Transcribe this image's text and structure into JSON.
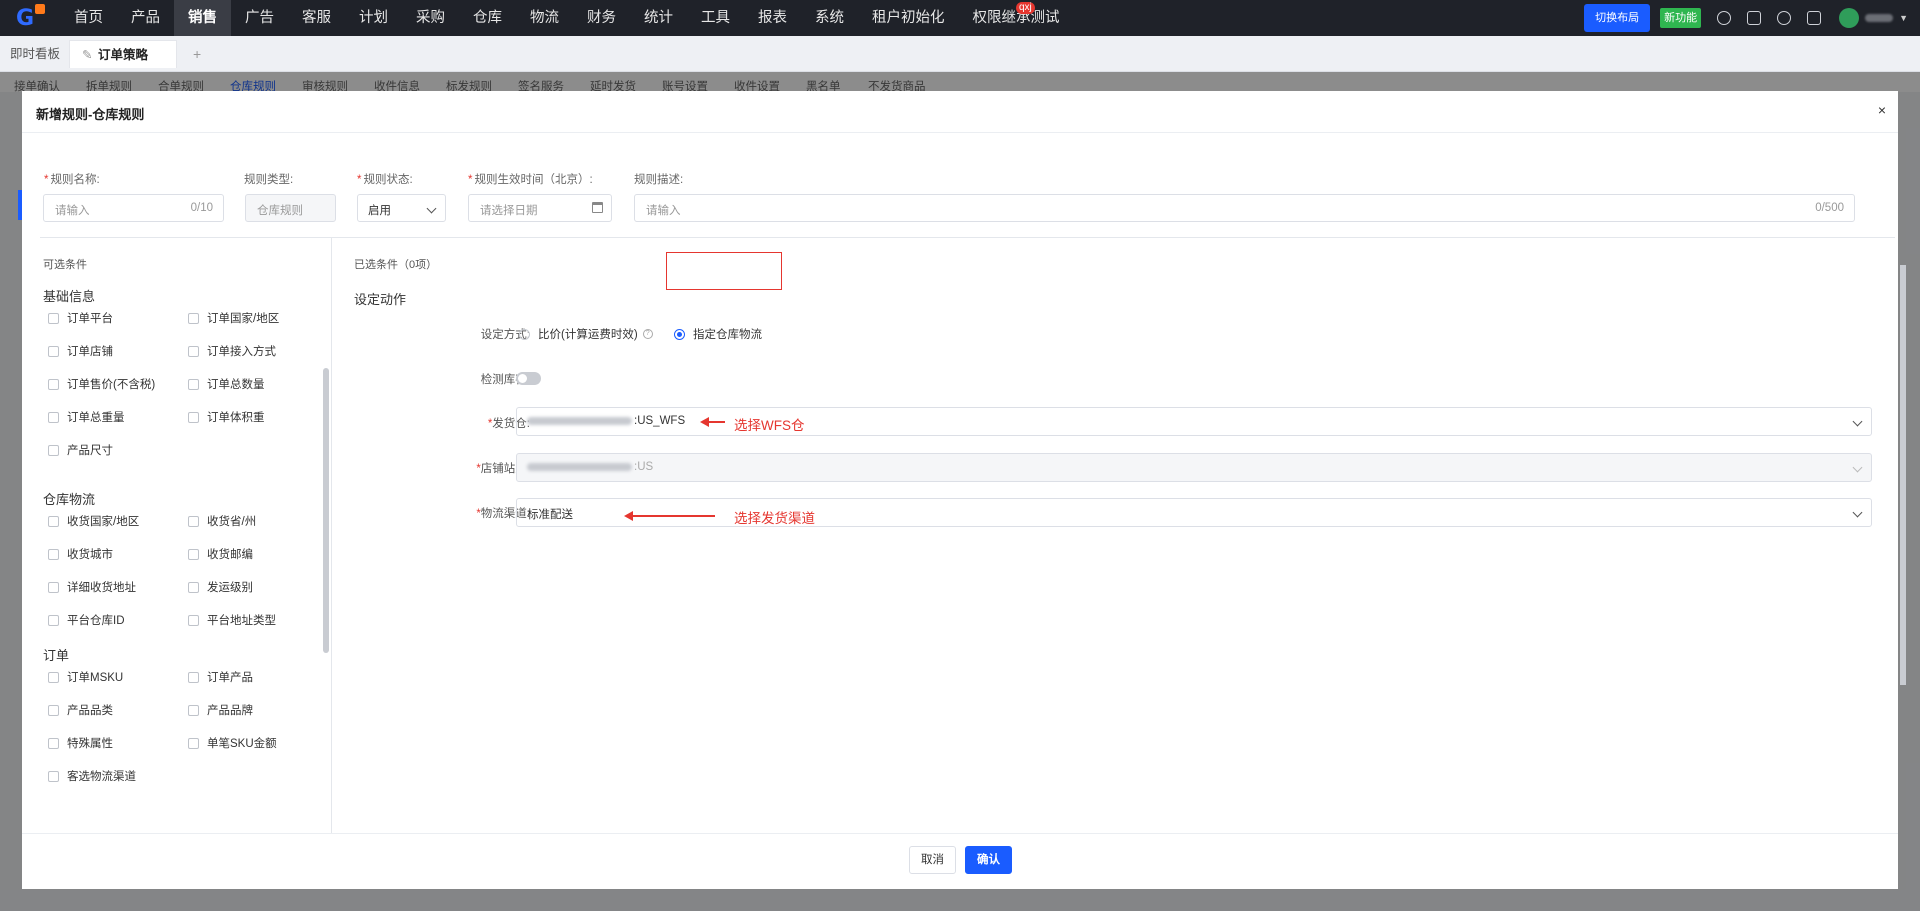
{
  "topnav": {
    "items": [
      "首页",
      "产品",
      "销售",
      "广告",
      "客服",
      "计划",
      "采购",
      "仓库",
      "物流",
      "财务",
      "统计",
      "工具",
      "报表",
      "系统",
      "租户初始化",
      "权限继承测试"
    ],
    "active_index": 2,
    "badge": "qxj",
    "switch_layout": "切换布局",
    "new_feature": "新功能"
  },
  "tabs": {
    "dashboard": "即时看板",
    "current": "订单策略",
    "add": "+"
  },
  "subtabs": [
    "接单确认",
    "拆单规则",
    "合单规则",
    "仓库规则",
    "审核规则",
    "收件信息",
    "标发规则",
    "签名服务",
    "延时发货",
    "账号设置",
    "收件设置",
    "黑名单",
    "不发货商品"
  ],
  "subtab_active_index": 3,
  "dialog": {
    "title": "新增规则-仓库规则",
    "close": "×",
    "form": {
      "name_label": "规则名称:",
      "name_placeholder": "请输入",
      "name_count": "0/10",
      "type_label": "规则类型:",
      "type_value": "仓库规则",
      "status_label": "规则状态:",
      "status_value": "启用",
      "time_label": "规则生效时间（北京）:",
      "time_placeholder": "请选择日期",
      "desc_label": "规则描述:",
      "desc_placeholder": "请输入",
      "desc_count": "0/500"
    },
    "left": {
      "title": "可选条件",
      "groups": [
        {
          "name": "基础信息",
          "items": [
            "订单平台",
            "订单国家/地区",
            "订单店铺",
            "订单接入方式",
            "订单售价(不含税)",
            "订单总数量",
            "订单总重量",
            "订单体积重",
            "产品尺寸"
          ]
        },
        {
          "name": "仓库物流",
          "items": [
            "收货国家/地区",
            "收货省/州",
            "收货城市",
            "收货邮编",
            "详细收货地址",
            "发运级别",
            "平台仓库ID",
            "平台地址类型"
          ]
        },
        {
          "name": "订单",
          "items": [
            "订单MSKU",
            "订单产品",
            "产品品类",
            "产品品牌",
            "特殊属性",
            "单笔SKU金额",
            "客选物流渠道"
          ]
        }
      ]
    },
    "right": {
      "selected_title": "已选条件（0项）",
      "action_title": "设定动作",
      "mode_label": "设定方式:",
      "mode_option1": "比价(计算运费时效)",
      "mode_option2": "指定仓库物流",
      "check_label": "检测库存:",
      "warehouse_label": "发货仓:",
      "warehouse_value": ":US_WFS",
      "store_label": "店铺站点:",
      "store_value": ":US",
      "channel_label": "物流渠道:",
      "channel_value": "标准配送",
      "annotation1": "选择WFS仓",
      "annotation2": "选择发货渠道"
    },
    "footer": {
      "cancel": "取消",
      "confirm": "确认"
    }
  }
}
